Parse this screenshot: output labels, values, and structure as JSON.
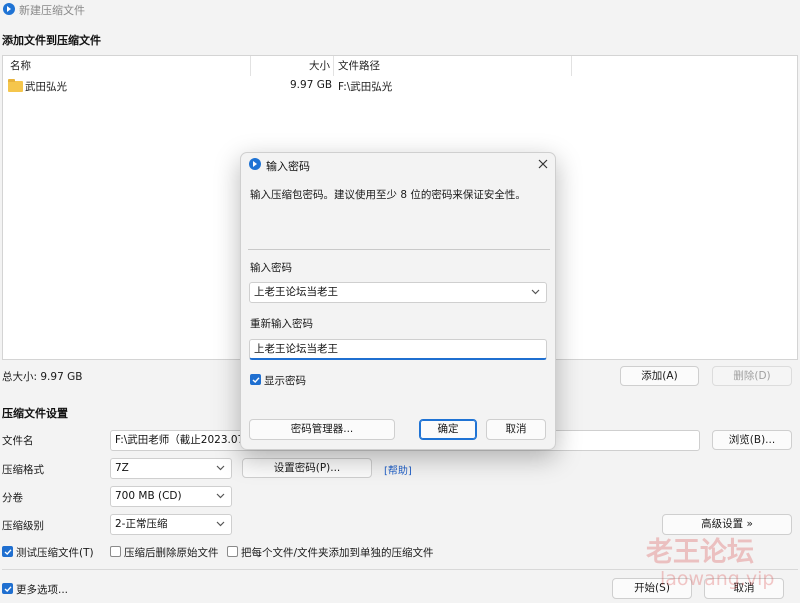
{
  "window": {
    "title": "新建压缩文件"
  },
  "files_section": {
    "title": "添加文件到压缩文件",
    "columns": {
      "name": "名称",
      "size": "大小",
      "path": "文件路径"
    },
    "rows": [
      {
        "name": "武田弘光",
        "size": "9.97 GB",
        "path": "F:\\武田弘光"
      }
    ],
    "total": "总大小: 9.97 GB",
    "add_button": "添加(A)",
    "delete_button": "删除(D)"
  },
  "settings": {
    "title": "压缩文件设置",
    "filename_label": "文件名",
    "filename_value": "F:\\武田老师（截止2023.07）",
    "browse_button": "浏览(B)...",
    "format_label": "压缩格式",
    "format_value": "7Z",
    "set_password_button": "设置密码(P)...",
    "help_link": "[帮助]",
    "split_label": "分卷",
    "split_value": "700 MB (CD)",
    "level_label": "压缩级别",
    "level_value": "2-正常压缩",
    "advanced_button": "高级设置 »",
    "options": [
      {
        "label": "测试压缩文件(T)",
        "checked": true
      },
      {
        "label": "压缩后删除原始文件",
        "checked": false
      },
      {
        "label": "把每个文件/文件夹添加到单独的压缩文件",
        "checked": false
      }
    ],
    "more_options": {
      "label": "更多选项...",
      "checked": true
    },
    "start_button": "开始(S)",
    "cancel_button": "取消"
  },
  "dialog": {
    "title": "输入密码",
    "description": "输入压缩包密码。建议使用至少 8 位的密码来保证安全性。",
    "password_label": "输入密码",
    "password_value": "上老王论坛当老王",
    "confirm_label": "重新输入密码",
    "confirm_value": "上老王论坛当老王",
    "show_password": {
      "label": "显示密码",
      "checked": true
    },
    "manager_button": "密码管理器...",
    "ok_button": "确定",
    "cancel_button": "取消"
  },
  "watermark": {
    "title": "老王论坛",
    "url": "laowang.vip"
  },
  "colors": {
    "accent": "#1f73d4",
    "link": "#1f5fc8",
    "folder": "#f5c64c"
  }
}
